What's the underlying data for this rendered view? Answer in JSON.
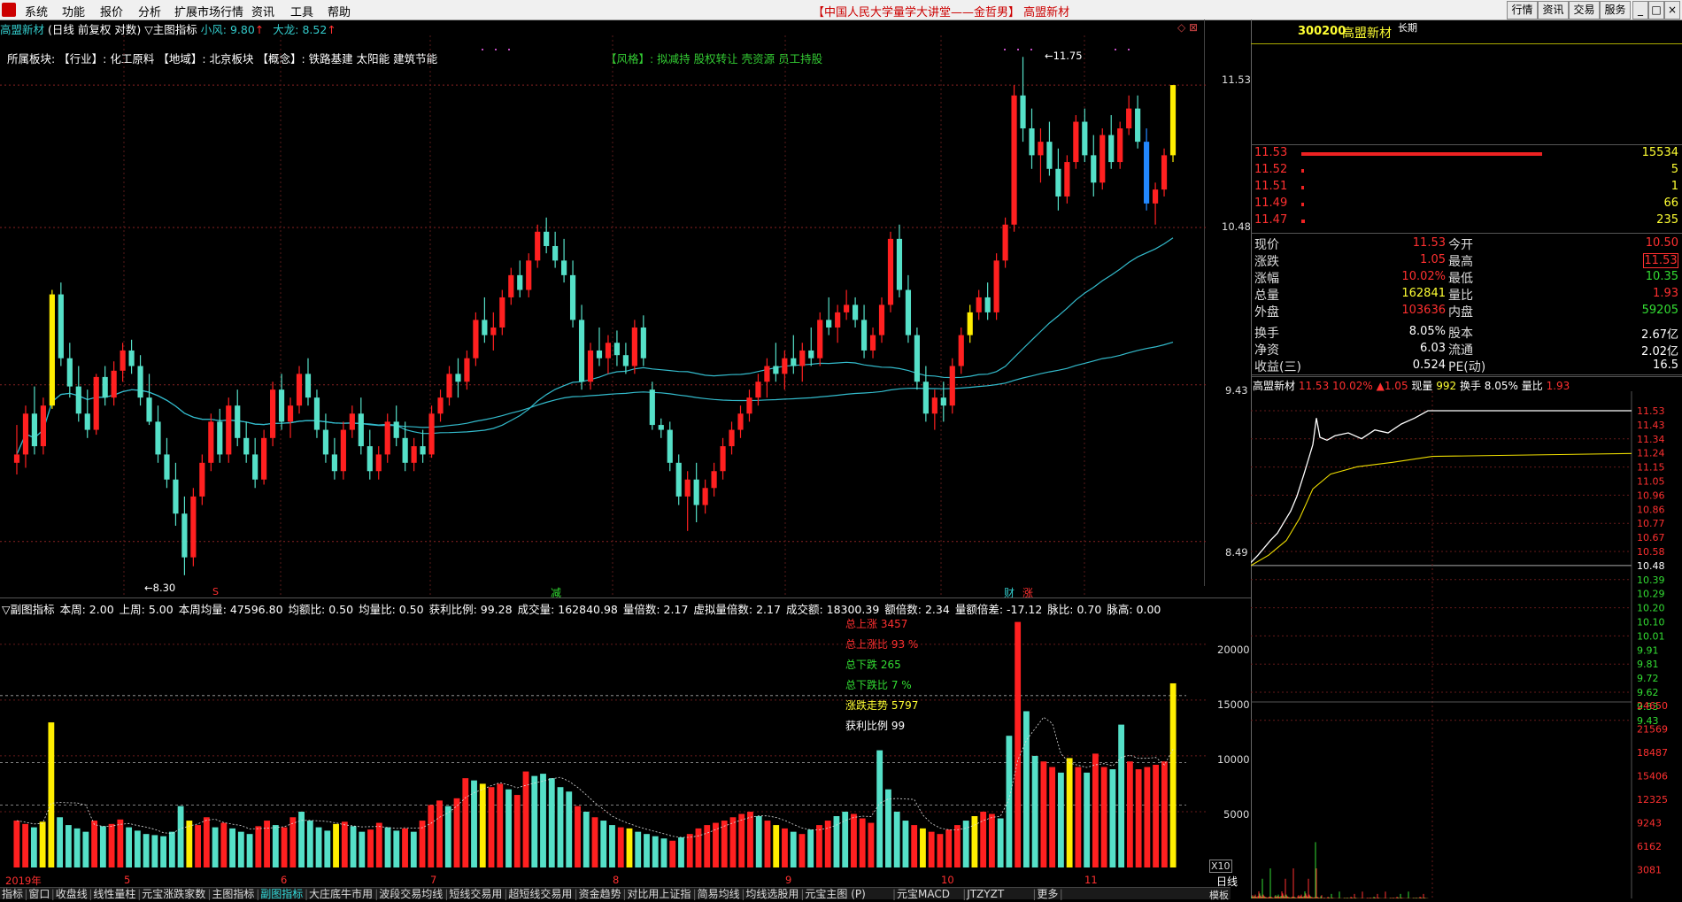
{
  "menubar": {
    "menus": [
      "系统",
      "功能",
      "报价",
      "分析",
      "扩展市场行情",
      "资讯",
      "工具",
      "帮助"
    ],
    "title": "【中国人民大学量学大讲堂——金哲男】 高盟新材",
    "right_buttons": [
      "行情",
      "资讯",
      "交易",
      "服务"
    ]
  },
  "chart": {
    "header": {
      "stock": "高盟新材",
      "mode": "(日线 前复权 对数)",
      "indicator": "▽主图指标",
      "small_wind": "小风: 9.80",
      "big_dragon": "大龙: 8.52"
    },
    "board_line": "所属板块:  【行业】: 化工原料  【地域】: 北京板块  【概念】: 铁路基建 太阳能 建筑节能",
    "style_line": "【风格】: 拟减持 股权转让 壳资源 员工持股",
    "y_labels": [
      "11.53",
      "10.48",
      "9.43",
      "8.49"
    ],
    "high_label": "11.75",
    "low_label": "8.30",
    "markers": {
      "s": "S",
      "jian": "减",
      "cai": "财",
      "zhang": "涨"
    },
    "x_labels": [
      "2019年",
      "5",
      "6",
      "7",
      "8",
      "9",
      "10",
      "11"
    ],
    "candles": [
      [
        8.95,
        9.18,
        8.88,
        9.0
      ],
      [
        9.0,
        9.3,
        8.92,
        9.25
      ],
      [
        9.25,
        9.42,
        9.0,
        9.05
      ],
      [
        9.05,
        9.35,
        9.0,
        9.3
      ],
      [
        9.3,
        10.05,
        9.28,
        10.02
      ],
      [
        10.02,
        10.1,
        9.55,
        9.6
      ],
      [
        9.6,
        9.7,
        9.35,
        9.42
      ],
      [
        9.42,
        9.55,
        9.2,
        9.25
      ],
      [
        9.25,
        9.4,
        9.1,
        9.15
      ],
      [
        9.15,
        9.5,
        9.12,
        9.48
      ],
      [
        9.48,
        9.55,
        9.3,
        9.35
      ],
      [
        9.35,
        9.58,
        9.3,
        9.52
      ],
      [
        9.52,
        9.7,
        9.45,
        9.65
      ],
      [
        9.65,
        9.72,
        9.5,
        9.55
      ],
      [
        9.55,
        9.62,
        9.3,
        9.35
      ],
      [
        9.35,
        9.5,
        9.18,
        9.2
      ],
      [
        9.2,
        9.3,
        8.95,
        9.0
      ],
      [
        9.0,
        9.1,
        8.8,
        8.85
      ],
      [
        8.85,
        8.95,
        8.58,
        8.65
      ],
      [
        8.65,
        8.75,
        8.3,
        8.4
      ],
      [
        8.4,
        8.8,
        8.35,
        8.75
      ],
      [
        8.75,
        9.0,
        8.7,
        8.95
      ],
      [
        8.95,
        9.25,
        8.9,
        9.2
      ],
      [
        9.2,
        9.28,
        8.95,
        9.0
      ],
      [
        9.0,
        9.35,
        8.95,
        9.3
      ],
      [
        9.3,
        9.4,
        9.05,
        9.1
      ],
      [
        9.1,
        9.2,
        8.95,
        9.0
      ],
      [
        9.0,
        9.1,
        8.8,
        8.85
      ],
      [
        8.85,
        9.15,
        8.82,
        9.1
      ],
      [
        9.1,
        9.45,
        9.05,
        9.4
      ],
      [
        9.4,
        9.5,
        9.15,
        9.2
      ],
      [
        9.2,
        9.35,
        9.1,
        9.3
      ],
      [
        9.3,
        9.55,
        9.25,
        9.5
      ],
      [
        9.5,
        9.6,
        9.3,
        9.35
      ],
      [
        9.35,
        9.4,
        9.1,
        9.15
      ],
      [
        9.15,
        9.25,
        8.95,
        9.0
      ],
      [
        9.0,
        9.1,
        8.85,
        8.9
      ],
      [
        8.9,
        9.2,
        8.85,
        9.15
      ],
      [
        9.15,
        9.3,
        9.1,
        9.25
      ],
      [
        9.25,
        9.35,
        9.0,
        9.05
      ],
      [
        9.05,
        9.15,
        8.85,
        8.9
      ],
      [
        8.9,
        9.05,
        8.85,
        9.0
      ],
      [
        9.0,
        9.25,
        8.95,
        9.2
      ],
      [
        9.2,
        9.3,
        9.05,
        9.1
      ],
      [
        9.1,
        9.2,
        8.9,
        8.95
      ],
      [
        8.95,
        9.1,
        8.9,
        9.05
      ],
      [
        9.05,
        9.15,
        8.95,
        9.0
      ],
      [
        9.0,
        9.3,
        8.98,
        9.25
      ],
      [
        9.25,
        9.4,
        9.2,
        9.35
      ],
      [
        9.35,
        9.55,
        9.3,
        9.5
      ],
      [
        9.5,
        9.6,
        9.35,
        9.45
      ],
      [
        9.45,
        9.65,
        9.4,
        9.6
      ],
      [
        9.6,
        9.9,
        9.55,
        9.85
      ],
      [
        9.85,
        10.0,
        9.7,
        9.75
      ],
      [
        9.75,
        9.9,
        9.65,
        9.8
      ],
      [
        9.8,
        10.05,
        9.75,
        10.0
      ],
      [
        10.0,
        10.2,
        9.95,
        10.15
      ],
      [
        10.15,
        10.25,
        10.0,
        10.05
      ],
      [
        10.05,
        10.3,
        10.0,
        10.25
      ],
      [
        10.25,
        10.5,
        10.2,
        10.45
      ],
      [
        10.45,
        10.55,
        10.3,
        10.35
      ],
      [
        10.35,
        10.45,
        10.2,
        10.25
      ],
      [
        10.25,
        10.4,
        10.1,
        10.15
      ],
      [
        10.15,
        10.25,
        9.8,
        9.85
      ],
      [
        9.85,
        9.95,
        9.4,
        9.45
      ],
      [
        9.45,
        9.7,
        9.4,
        9.65
      ],
      [
        9.65,
        9.8,
        9.55,
        9.6
      ],
      [
        9.6,
        9.75,
        9.5,
        9.7
      ],
      [
        9.7,
        9.78,
        9.55,
        9.62
      ],
      [
        9.62,
        9.7,
        9.5,
        9.55
      ],
      [
        9.55,
        9.85,
        9.5,
        9.8
      ],
      [
        9.8,
        9.88,
        9.55,
        9.6
      ],
      [
        9.4,
        9.45,
        9.15,
        9.18
      ],
      [
        9.18,
        9.22,
        9.1,
        9.15
      ],
      [
        9.15,
        9.2,
        8.9,
        8.95
      ],
      [
        8.95,
        9.0,
        8.7,
        8.75
      ],
      [
        8.75,
        8.9,
        8.55,
        8.85
      ],
      [
        8.85,
        8.95,
        8.6,
        8.7
      ],
      [
        8.7,
        8.85,
        8.65,
        8.8
      ],
      [
        8.8,
        8.95,
        8.75,
        8.9
      ],
      [
        8.9,
        9.1,
        8.85,
        9.05
      ],
      [
        9.05,
        9.2,
        9.0,
        9.15
      ],
      [
        9.15,
        9.3,
        9.1,
        9.25
      ],
      [
        9.25,
        9.4,
        9.2,
        9.35
      ],
      [
        9.35,
        9.5,
        9.3,
        9.45
      ],
      [
        9.45,
        9.6,
        9.35,
        9.55
      ],
      [
        9.55,
        9.7,
        9.45,
        9.5
      ],
      [
        9.5,
        9.65,
        9.4,
        9.6
      ],
      [
        9.6,
        9.75,
        9.5,
        9.55
      ],
      [
        9.55,
        9.7,
        9.45,
        9.65
      ],
      [
        9.65,
        9.8,
        9.55,
        9.6
      ],
      [
        9.6,
        9.9,
        9.55,
        9.85
      ],
      [
        9.85,
        10.0,
        9.75,
        9.8
      ],
      [
        9.8,
        9.95,
        9.7,
        9.9
      ],
      [
        9.9,
        10.05,
        9.85,
        9.95
      ],
      [
        9.95,
        10.0,
        9.8,
        9.85
      ],
      [
        9.85,
        9.95,
        9.6,
        9.65
      ],
      [
        9.65,
        9.8,
        9.6,
        9.75
      ],
      [
        9.75,
        10.0,
        9.7,
        9.95
      ],
      [
        9.95,
        10.45,
        9.9,
        10.4
      ],
      [
        10.4,
        10.5,
        10.0,
        10.05
      ],
      [
        10.05,
        10.15,
        9.7,
        9.75
      ],
      [
        9.75,
        9.8,
        9.4,
        9.45
      ],
      [
        9.45,
        9.55,
        9.2,
        9.25
      ],
      [
        9.25,
        9.4,
        9.15,
        9.35
      ],
      [
        9.35,
        9.45,
        9.2,
        9.3
      ],
      [
        9.3,
        9.6,
        9.25,
        9.55
      ],
      [
        9.55,
        9.8,
        9.5,
        9.75
      ],
      [
        9.75,
        9.95,
        9.7,
        9.9
      ],
      [
        9.9,
        10.05,
        9.85,
        10.0
      ],
      [
        10.0,
        10.1,
        9.85,
        9.9
      ],
      [
        9.9,
        10.3,
        9.85,
        10.25
      ],
      [
        10.25,
        10.55,
        10.2,
        10.5
      ],
      [
        10.5,
        11.53,
        10.45,
        11.45
      ],
      [
        11.45,
        11.75,
        11.1,
        11.2
      ],
      [
        11.2,
        11.35,
        10.9,
        11.0
      ],
      [
        11.0,
        11.2,
        10.8,
        11.1
      ],
      [
        11.1,
        11.25,
        10.85,
        10.9
      ],
      [
        10.9,
        11.05,
        10.6,
        10.7
      ],
      [
        10.7,
        11.0,
        10.65,
        10.95
      ],
      [
        10.95,
        11.3,
        10.9,
        11.25
      ],
      [
        11.25,
        11.35,
        10.95,
        11.0
      ],
      [
        11.0,
        11.15,
        10.7,
        10.8
      ],
      [
        10.8,
        11.2,
        10.75,
        11.15
      ],
      [
        11.15,
        11.3,
        10.9,
        10.95
      ],
      [
        10.95,
        11.25,
        10.9,
        11.2
      ],
      [
        11.2,
        11.45,
        11.15,
        11.35
      ],
      [
        11.35,
        11.45,
        11.05,
        11.1
      ],
      [
        11.1,
        11.2,
        10.6,
        10.65
      ],
      [
        10.65,
        10.8,
        10.5,
        10.75
      ],
      [
        10.75,
        11.05,
        10.7,
        11.0
      ],
      [
        11.0,
        11.53,
        10.95,
        11.53
      ]
    ]
  },
  "sub": {
    "header": [
      {
        "text": "▽副图指标",
        "color": "white"
      },
      {
        "text": "本周: 2.00",
        "color": "white"
      },
      {
        "text": "上周: 5.00",
        "color": "white"
      },
      {
        "text": "本周均量: 47596.80",
        "color": "white"
      },
      {
        "text": "均额比: 0.50",
        "color": "white"
      },
      {
        "text": "均量比: 0.50",
        "color": "white"
      },
      {
        "text": "获利比例: 99.28",
        "color": "white"
      },
      {
        "text": "成交量: 162840.98",
        "color": "white"
      },
      {
        "text": "量倍数: 2.17",
        "color": "white"
      },
      {
        "text": "虚拟量倍数: 2.17",
        "color": "white"
      },
      {
        "text": "成交额: 18300.39",
        "color": "white"
      },
      {
        "text": "额倍数: 2.34",
        "color": "white"
      },
      {
        "text": "量额倍差: -17.12",
        "color": "white"
      },
      {
        "text": "脉比: 0.70",
        "color": "white"
      },
      {
        "text": "脉高: 0.00",
        "color": "white"
      }
    ],
    "stats": [
      {
        "text": "总上涨 3457",
        "color": "red"
      },
      {
        "text": "总上涨比 93 %",
        "color": "red"
      },
      {
        "text": "总下跌 265",
        "color": "green"
      },
      {
        "text": "总下跌比 7 %",
        "color": "green"
      },
      {
        "text": "涨跌走势 5797",
        "color": "yellow"
      },
      {
        "text": "获利比例 99",
        "color": "white"
      }
    ],
    "y_labels": [
      "20000",
      "15000",
      "10000",
      "5000"
    ],
    "x10": "X10",
    "volumes": [
      4200,
      3900,
      3600,
      4100,
      13000,
      4500,
      3800,
      3500,
      3200,
      4200,
      3700,
      3900,
      4300,
      3600,
      3300,
      3000,
      2900,
      2800,
      3200,
      5500,
      4200,
      3800,
      4500,
      3600,
      4000,
      3500,
      3200,
      3000,
      3700,
      4200,
      3800,
      3600,
      4500,
      5000,
      4200,
      3600,
      3300,
      3900,
      4100,
      3700,
      3200,
      3400,
      4000,
      3600,
      3300,
      3500,
      3200,
      4200,
      5600,
      6000,
      5500,
      6200,
      8000,
      7800,
      7500,
      7200,
      7500,
      7000,
      6500,
      8600,
      8200,
      8400,
      8000,
      7200,
      6800,
      5500,
      5000,
      4500,
      4200,
      3800,
      3600,
      3500,
      3200,
      3000,
      2800,
      2600,
      2400,
      2700,
      3000,
      3500,
      3800,
      4000,
      4200,
      4500,
      4800,
      5000,
      4600,
      4200,
      3800,
      3500,
      3200,
      3000,
      3400,
      3800,
      4200,
      4600,
      5000,
      4800,
      4400,
      4000,
      10500,
      7000,
      5000,
      4200,
      3800,
      3500,
      3200,
      3000,
      3400,
      3800,
      4200,
      4600,
      5000,
      4800,
      4400,
      11800,
      22000,
      14000,
      10000,
      9500,
      9000,
      8500,
      9800,
      9000,
      8500,
      10200,
      9000,
      8800,
      12800,
      9500,
      8800,
      9000,
      9200,
      9500,
      16500
    ]
  },
  "bottom": {
    "tabs": [
      "指标",
      "窗口",
      "收盘线",
      "线性量柱",
      "元宝涨跌家数",
      "主图指标",
      "副图指标",
      "大庄底牛市用",
      "波段交易均线",
      "短线交易用",
      "超短线交易用",
      "资金趋势",
      "对比用上证指",
      "简易均线",
      "均线选股用",
      "元宝主图 (P)",
      "元宝MACD",
      "JTZYZT",
      "更多"
    ],
    "right": "日线",
    "template": "模板"
  },
  "quote": {
    "code": "300200",
    "name": "高盟新材",
    "tag": "长期",
    "bids": [
      {
        "price": "11.53",
        "vol": "15534"
      },
      {
        "price": "11.52",
        "vol": "5"
      },
      {
        "price": "11.51",
        "vol": "1"
      },
      {
        "price": "11.49",
        "vol": "66"
      },
      {
        "price": "11.47",
        "vol": "235"
      }
    ],
    "rows": [
      {
        "l1": "现价",
        "v1": "11.53",
        "l2": "今开",
        "v2": "10.50"
      },
      {
        "l1": "涨跌",
        "v1": "1.05",
        "l2": "最高",
        "v2": "11.53"
      },
      {
        "l1": "涨幅",
        "v1": "10.02%",
        "l2": "最低",
        "v2": "10.35"
      },
      {
        "l1": "总量",
        "v1": "162841",
        "l2": "量比",
        "v2": "1.93"
      },
      {
        "l1": "外盘",
        "v1": "103636",
        "l2": "内盘",
        "v2": "59205"
      },
      {
        "l1": "换手",
        "v1": "8.05%",
        "l2": "股本",
        "v2": "2.67亿"
      },
      {
        "l1": "净资",
        "v1": "6.03",
        "l2": "流通",
        "v2": "2.02亿"
      },
      {
        "l1": "收益(三)",
        "v1": "0.524",
        "l2": "PE(动)",
        "v2": "16.5"
      }
    ],
    "intraday_header": {
      "name": "高盟新材",
      "price": "11.53",
      "pct": "10.02%",
      "chg": "▲1.05",
      "vol_label": "现量",
      "vol": "992",
      "turn": "换手 8.05%",
      "ratio_label": "量比",
      "ratio": "1.93"
    },
    "intraday_y": [
      "11.53",
      "11.43",
      "11.34",
      "11.24",
      "11.15",
      "11.05",
      "10.96",
      "10.86",
      "10.77",
      "10.67",
      "10.58",
      "10.48",
      "10.39",
      "10.29",
      "10.20",
      "10.10",
      "10.01",
      "9.91",
      "9.81",
      "9.72",
      "9.62",
      "9.53",
      "9.43"
    ],
    "intraday_vol_y": [
      "24650",
      "21569",
      "18487",
      "15406",
      "12325",
      "9243",
      "6162",
      "3081"
    ]
  },
  "colors": {
    "up": "#ff2020",
    "down": "#55e0c8",
    "ma": "#33bbcc",
    "yellow": "#ffee00",
    "panel_bg": "#000000"
  }
}
